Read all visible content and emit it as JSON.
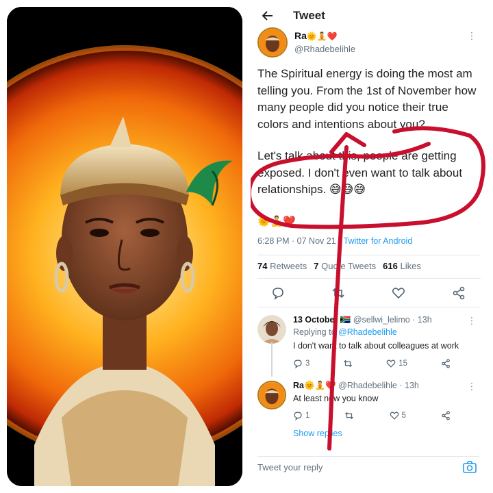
{
  "header": {
    "title": "Tweet"
  },
  "tweet": {
    "author_name": "Ra",
    "author_emoji": "🌞🧘❤️",
    "author_handle": "@Rhadebelihle",
    "paragraph1": "The Spiritual energy is doing the most am telling you. From the 1st of November how many people did you notice their true colors and intentions about you?",
    "paragraph2": "Let's talk about this, people are getting exposed. I don't even want to talk about relationships. 😅😅😅",
    "emoji_line": "🌞🧘❤️",
    "time": "6:28 PM · 07 Nov 21 · ",
    "via": "Twitter for Android",
    "retweets_count": "74",
    "retweets_label": "Retweets",
    "quotes_count": "7",
    "quotes_label": "Quote Tweets",
    "likes_count": "616",
    "likes_label": "Likes"
  },
  "replies": [
    {
      "name": "13 October 🇿🇦",
      "handle": "@sellwi_lelimo · 13h",
      "replying_prefix": "Replying to ",
      "replying_to": "@Rhadebelihle",
      "text": "I don't want to talk about colleagues at work",
      "reply_count": "3",
      "retweet_count": "",
      "like_count": "15"
    },
    {
      "name": "Ra🌞🧘❤️",
      "handle": "@Rhadebelihle · 13h",
      "text": "At least now you know",
      "reply_count": "1",
      "retweet_count": "",
      "like_count": "5"
    }
  ],
  "show_replies": "Show replies",
  "composer": {
    "placeholder": "Tweet your reply"
  },
  "colors": {
    "accent": "#1d9bf0",
    "annotation": "#c8102e",
    "muted": "#607080"
  },
  "icons": [
    "back-arrow-icon",
    "more-icon",
    "reply-icon",
    "retweet-icon",
    "like-icon",
    "share-icon",
    "camera-icon"
  ]
}
